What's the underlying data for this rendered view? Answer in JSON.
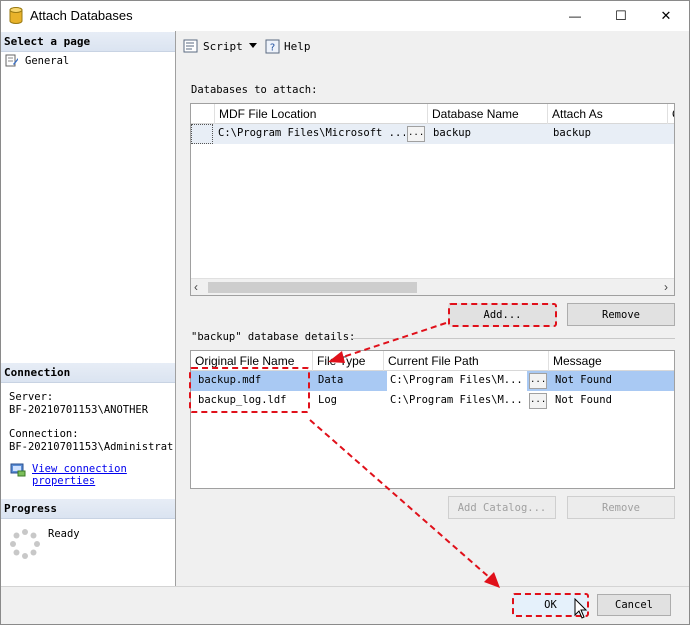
{
  "window": {
    "title": "Attach Databases",
    "minimize_glyph": "—",
    "maximize_glyph": "☐",
    "close_glyph": "✕"
  },
  "left": {
    "select_page": "Select a page",
    "pages": [
      {
        "label": "General"
      }
    ],
    "connection_head": "Connection",
    "server_label": "Server:",
    "server_value": "BF-20210701153\\ANOTHER",
    "connection_label": "Connection:",
    "connection_value": "BF-20210701153\\Administrat",
    "view_link_line1": "View connection",
    "view_link_line2": "properties",
    "progress_head": "Progress",
    "progress_status": "Ready"
  },
  "toolbar": {
    "script_label": "Script",
    "help_label": "Help"
  },
  "attach": {
    "label": "Databases to attach:",
    "columns": [
      "MDF File Location",
      "Database Name",
      "Attach As",
      "O"
    ],
    "rows": [
      {
        "mdf": "C:\\Program Files\\Microsoft ...",
        "ellipsis": "...",
        "db_name": "backup",
        "attach_as": "backup"
      }
    ],
    "add_label": "Add...",
    "remove_label": "Remove"
  },
  "details": {
    "label": "\"backup\" database details:",
    "columns": [
      "Original File Name",
      "File Type",
      "Current File Path",
      "Message"
    ],
    "rows": [
      {
        "file": "backup.mdf",
        "type": "Data",
        "path": "C:\\Program Files\\M...",
        "ellipsis": "...",
        "message": "Not Found"
      },
      {
        "file": "backup_log.ldf",
        "type": "Log",
        "path": "C:\\Program Files\\M...",
        "ellipsis": "...",
        "message": "Not Found"
      }
    ],
    "add_catalog_label": "Add Catalog...",
    "remove_label": "Remove"
  },
  "footer": {
    "ok_label": "OK",
    "cancel_label": "Cancel"
  },
  "colors": {
    "accent_red": "#e0101a",
    "selected_row": "#a9c9f3",
    "section_head": "#dbe4f1"
  }
}
